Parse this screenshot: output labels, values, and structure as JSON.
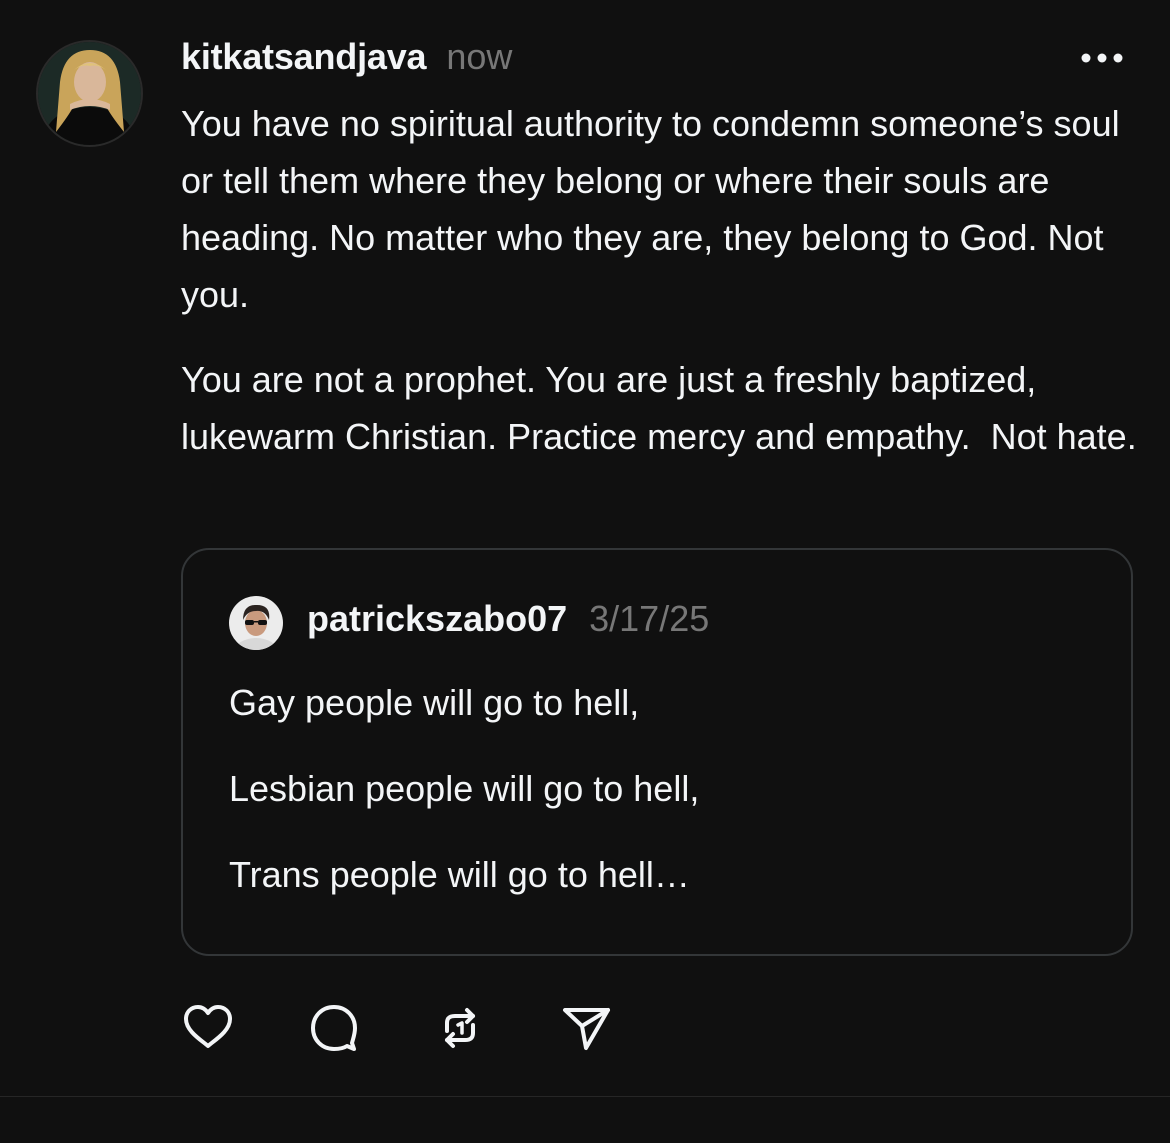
{
  "post": {
    "username": "kitkatsandjava",
    "time": "now",
    "paragraphs": [
      "You have no spiritual authority to condemn someone’s soul or tell them where they belong or where their souls are heading. No matter who they are, they belong to God. Not you.",
      "You are not a prophet. You are just a freshly baptized, lukewarm Christian. Practice mercy and empathy.  Not hate."
    ],
    "more_icon": "ellipsis-icon"
  },
  "quoted_post": {
    "username": "patrickszabo07",
    "date": "3/17/25",
    "lines": [
      "Gay people will go to hell,",
      "Lesbian people will go to hell,",
      "Trans people will go to hell…"
    ]
  },
  "actions": {
    "icons": [
      "heart-icon",
      "comment-icon",
      "repost-icon",
      "share-icon"
    ]
  },
  "colors": {
    "background": "#101010",
    "primary_text": "#f3f5f7",
    "secondary_text": "#777777",
    "border": "#333638"
  }
}
